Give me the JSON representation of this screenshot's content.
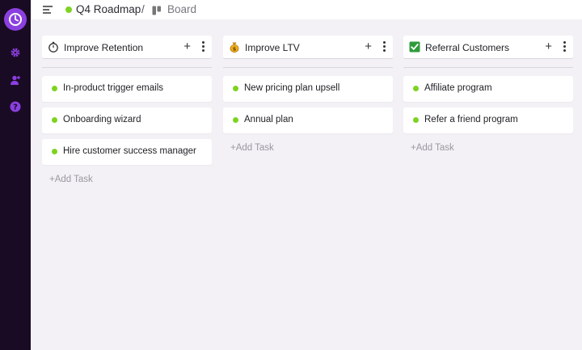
{
  "colors": {
    "sidebar_bg": "#1a0b24",
    "accent": "#8b3fe0",
    "status_green": "#7ed321",
    "page_bg": "#f3f1f5"
  },
  "sidebar": {
    "logo_icon": "logo-clock-icon",
    "items": [
      {
        "icon": "gear-icon"
      },
      {
        "icon": "user-add-icon"
      },
      {
        "icon": "help-icon"
      }
    ]
  },
  "header": {
    "menu_icon": "menu-lines-icon",
    "project": "Q4 Roadmap",
    "separator": "/",
    "view_icon": "board-icon",
    "view": "Board"
  },
  "columns": [
    {
      "title": "Improve Retention",
      "icon": "stopwatch-icon",
      "add_label": "+",
      "tasks": [
        "In-product trigger emails",
        "Onboarding wizard",
        "Hire customer success manager"
      ],
      "add_task": "+Add Task"
    },
    {
      "title": "Improve LTV",
      "icon": "money-bag-icon",
      "add_label": "+",
      "tasks": [
        "New pricing plan upsell",
        "Annual plan"
      ],
      "add_task": "+Add Task"
    },
    {
      "title": "Referral Customers",
      "icon": "check-box-icon",
      "add_label": "+",
      "tasks": [
        "Affiliate program",
        "Refer a friend program"
      ],
      "add_task": "+Add Task"
    }
  ]
}
